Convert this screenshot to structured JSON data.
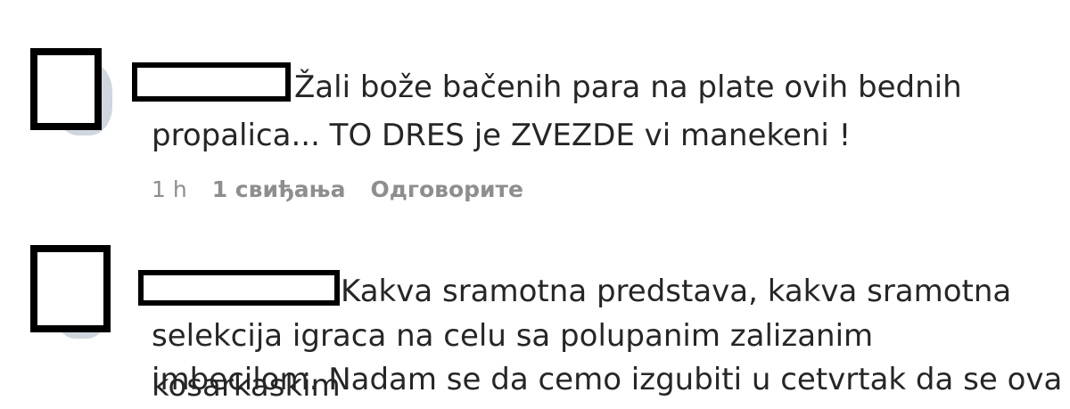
{
  "comments": [
    {
      "lines": [
        "Žali bože bačenih para na plate ovih bednih",
        "propalica... TO DRES je ZVEZDE vi manekeni !"
      ],
      "time": "1 h",
      "likes": "1 свиђања",
      "reply_label": "Одговорите"
    },
    {
      "lines": [
        "Kakva sramotna predstava, kakva sramotna",
        "selekcija igraca na celu sa polupanim zalizanim kosarkaskim",
        "imbecilom. Nadam se da cemo izgubiti u cetvrtak da se ova"
      ]
    }
  ]
}
